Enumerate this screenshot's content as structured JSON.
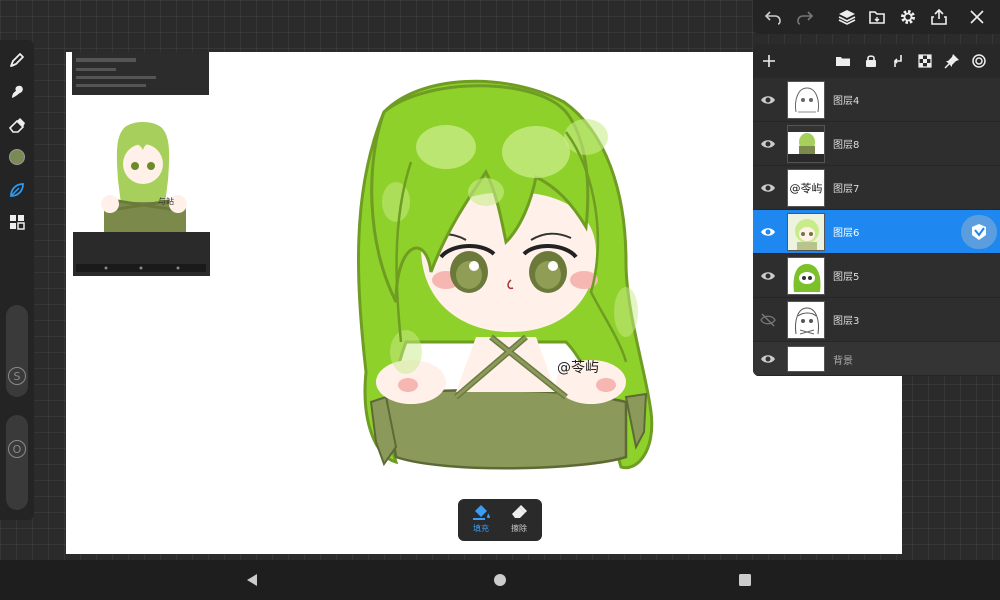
{
  "colors": {
    "accent": "#1e88f0",
    "hair": "#8ed12a",
    "hair_highlight": "#c9ec8a",
    "outfit": "#8b9a5a",
    "color_swatch": "#7b8a55"
  },
  "left_toolbar": {
    "tools": [
      "brush-icon",
      "smudge-icon",
      "eraser-icon",
      "color-swatch",
      "leaf-brush-icon",
      "layout-icon"
    ],
    "size_slider_label": "S",
    "opacity_slider_label": "O"
  },
  "top_toolbar": {
    "icons": [
      "undo-icon",
      "redo-icon",
      "layers-icon",
      "import-icon",
      "settings-icon",
      "share-icon",
      "close-icon"
    ]
  },
  "layer_panel": {
    "header_icons": [
      "add-icon",
      "folder-icon",
      "lock-icon",
      "merge-down-icon",
      "checker-icon",
      "pin-icon",
      "target-icon"
    ],
    "layers": [
      {
        "name": "图层4",
        "visible": true,
        "selected": false
      },
      {
        "name": "图层8",
        "visible": true,
        "selected": false
      },
      {
        "name": "图层7",
        "visible": true,
        "selected": false,
        "thumb_text": "@苓屿"
      },
      {
        "name": "图层6",
        "visible": true,
        "selected": true
      },
      {
        "name": "图层5",
        "visible": true,
        "selected": false
      },
      {
        "name": "图层3",
        "visible": false,
        "selected": false
      },
      {
        "name": "背景",
        "visible": true,
        "selected": false
      }
    ]
  },
  "canvas": {
    "signature": "@苓屿",
    "ref_sign_text": "与站"
  },
  "fill_popup": {
    "fill_label": "填充",
    "erase_label": "擦除"
  },
  "nav": {
    "icons": [
      "back-icon",
      "home-icon",
      "recents-icon"
    ]
  }
}
